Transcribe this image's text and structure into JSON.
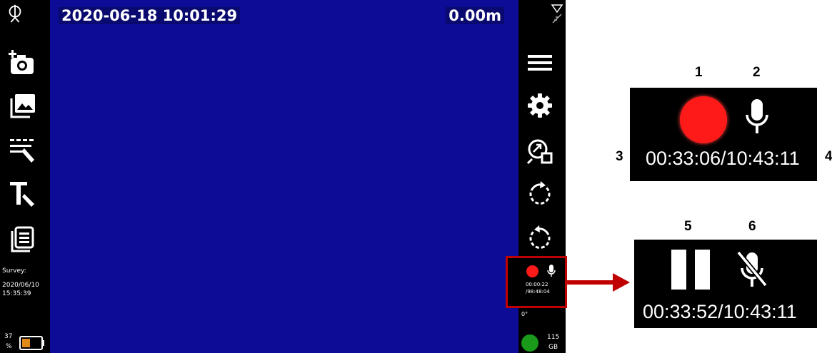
{
  "camera": {
    "datetime": "2020-06-18 10:01:29",
    "distance": "0.00m"
  },
  "left_toolbar": {
    "survey_label": "Survey:",
    "survey_date": "2020/06/10",
    "survey_time": "15:35:39",
    "battery_percent": "37",
    "battery_unit": "%"
  },
  "right_toolbar": {
    "recording": {
      "elapsed": "00:00:22",
      "total": "/98:48:04"
    },
    "angle": "0°",
    "storage_value": "115",
    "storage_unit": "GB"
  },
  "callouts": {
    "top_panel": {
      "elapsed": "00:33:06",
      "total": "/10:43:11"
    },
    "bottom_panel": {
      "elapsed": "00:33:52",
      "total": "/10:43:11"
    },
    "labels": [
      "1",
      "2",
      "3",
      "4",
      "5",
      "6"
    ]
  },
  "colors": {
    "camera_bg": "#0c0c96",
    "record_red": "#ff1a1a",
    "highlight": "#c00000",
    "storage_ok": "#1a9a1a",
    "battery": "#e08a1a"
  }
}
